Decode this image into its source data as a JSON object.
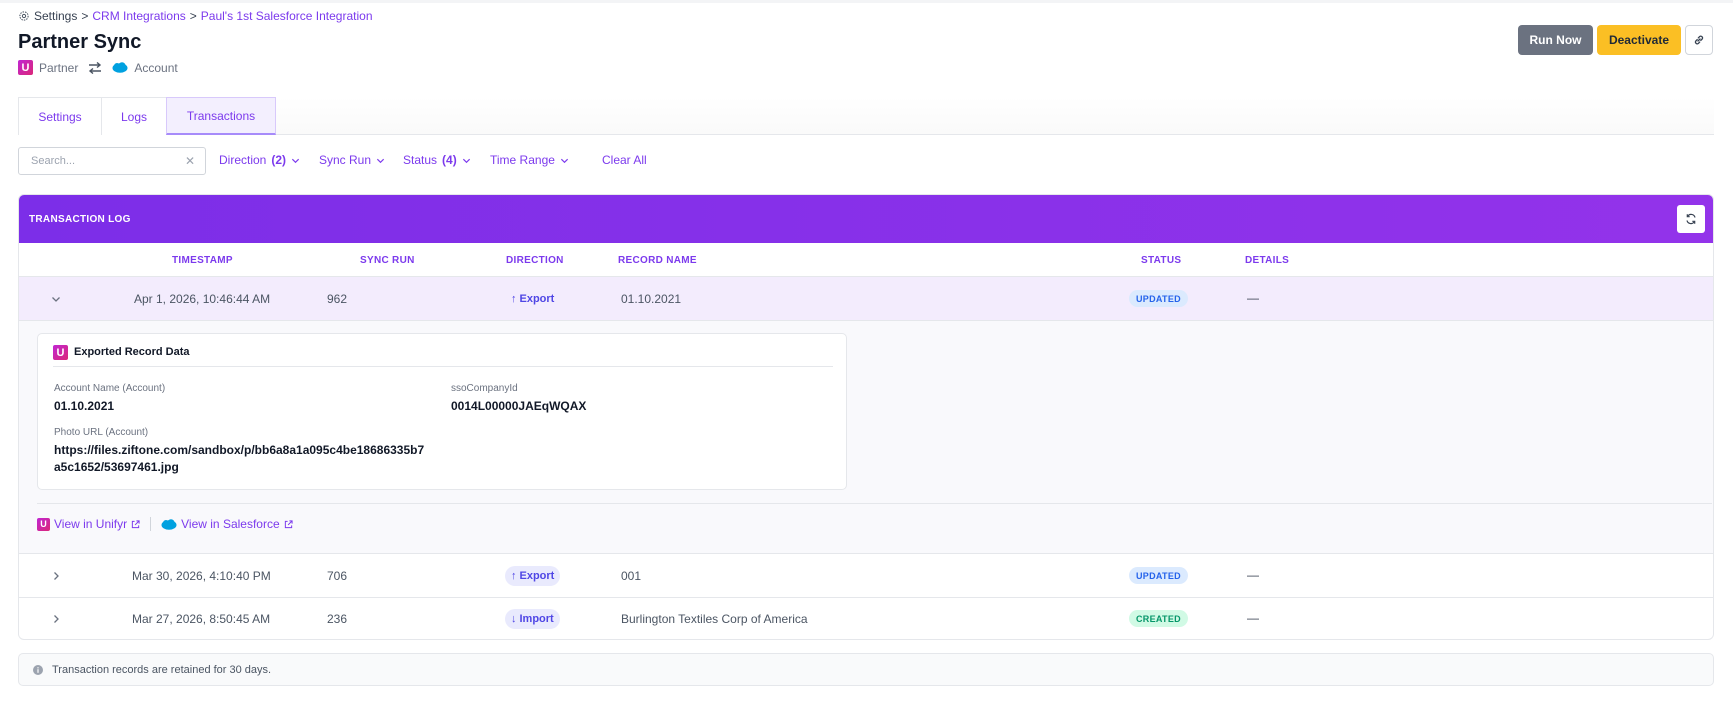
{
  "breadcrumb": {
    "root": "Settings",
    "sep": ">",
    "crumb1": "CRM Integrations",
    "crumb2": "Paul's 1st Salesforce Integration"
  },
  "page": {
    "title": "Partner Sync",
    "source_label": "Partner",
    "target_label": "Account",
    "u_logo_letter": "U"
  },
  "header_buttons": {
    "run_now": "Run Now",
    "deactivate": "Deactivate"
  },
  "tabs": [
    "Settings",
    "Logs",
    "Transactions"
  ],
  "filters": {
    "search_placeholder": "Search...",
    "clear_x": "✕",
    "direction": "Direction",
    "direction_count": "(2)",
    "sync_run": "Sync Run",
    "status": "Status",
    "status_count": "(4)",
    "time_range": "Time Range",
    "clear_all": "Clear All"
  },
  "panel": {
    "title": "TRANSACTION LOG",
    "columns": {
      "timestamp": "TIMESTAMP",
      "sync_run": "SYNC RUN",
      "direction": "DIRECTION",
      "record_name": "RECORD NAME",
      "status": "STATUS",
      "details": "DETAILS"
    }
  },
  "rows": [
    {
      "timestamp": "Apr 1, 2026, 10:46:44 AM",
      "sync_run": "962",
      "direction": "Export",
      "dir_arrow": "↑",
      "record_name": "01.10.2021",
      "status": "UPDATED",
      "details": "—"
    },
    {
      "timestamp": "Mar 30, 2026, 4:10:40 PM",
      "sync_run": "706",
      "direction": "Export",
      "dir_arrow": "↑",
      "record_name": "001",
      "status": "UPDATED",
      "details": "—"
    },
    {
      "timestamp": "Mar 27, 2026, 8:50:45 AM",
      "sync_run": "236",
      "direction": "Import",
      "dir_arrow": "↓",
      "record_name": "Burlington Textiles Corp of America",
      "status": "CREATED",
      "details": "—"
    }
  ],
  "detail": {
    "card_title": "Exported Record Data",
    "fields": [
      {
        "label": "Account Name (Account)",
        "value": "01.10.2021"
      },
      {
        "label": "ssoCompanyId",
        "value": "0014L00000JAEqWQAX"
      },
      {
        "label": "Photo URL (Account)",
        "value_line1": "https://files.ziftone.com/sandbox/p/bb6a8a1a095c4be18686335b7",
        "value_line2": "a5c1652/53697461.jpg"
      }
    ],
    "view_unifyr": "View in Unifyr",
    "view_salesforce": "View in Salesforce"
  },
  "note": "Transaction records are retained for 30 days.",
  "colors": {
    "accent": "#7c3aed",
    "header_gradient_start": "#7c2ee8",
    "header_gradient_end": "#9333ea",
    "run_now_bg": "#6b7280",
    "deactivate_bg": "#fbbf24",
    "updated_badge": "#dbeafe",
    "created_badge": "#d1fae5"
  },
  "icons": [
    "gear-icon",
    "unifyr-logo-icon",
    "swap-arrows-icon",
    "salesforce-cloud-icon",
    "link-icon",
    "chevron-down-icon",
    "refresh-icon",
    "chevron-right-icon",
    "external-link-icon",
    "info-icon"
  ]
}
